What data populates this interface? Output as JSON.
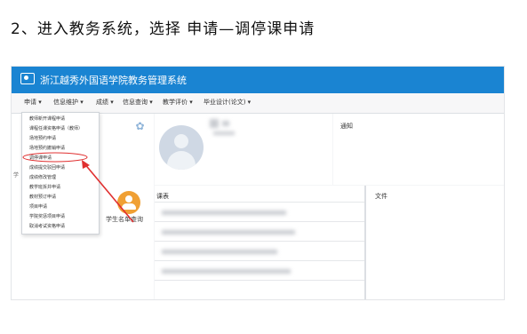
{
  "heading": "2、进入教务系统，选择  申请—调停课申请",
  "app": {
    "title": "浙江越秀外国语学院教务管理系统"
  },
  "menubar": {
    "items": [
      "申请 ▾",
      "信息维护 ▾",
      "成绩 ▾",
      "信息查询 ▾",
      "教学评价 ▾",
      "毕业设计(论文) ▾"
    ]
  },
  "dropdown": {
    "items": [
      "教师新开课程申请",
      "课程任课资格申请（教师）",
      "场地预约申请",
      "场地预约撤销申请",
      "调停课申请",
      "成绩提交驳回申请",
      "成绩修改管理",
      "教学班拆并申请",
      "教材预订申请",
      "项目申请",
      "学院奖惩项目申请",
      "取消考试资格申请"
    ],
    "highlighted_index": 4
  },
  "side": {
    "cut_label": "学"
  },
  "quick": {
    "label": "学生名单查询"
  },
  "notice": {
    "title": "通知"
  },
  "schedule": {
    "title": "课表"
  },
  "files": {
    "title": "文件"
  },
  "colors": {
    "titlebar": "#1a84d2",
    "highlight": "#e03030",
    "quick_icon": "#f0a034"
  }
}
